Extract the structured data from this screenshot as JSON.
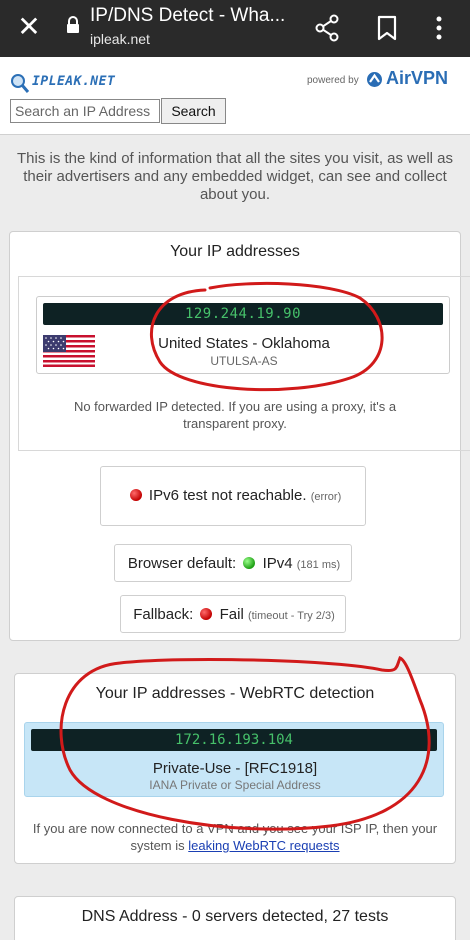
{
  "browser": {
    "close_icon": "close-icon",
    "lock_icon": "lock-icon",
    "title": "IP/DNS Detect - Wha...",
    "url": "ipleak.net",
    "share_icon": "share-icon",
    "bookmark_icon": "bookmark-icon",
    "menu_icon": "more-vert-icon"
  },
  "header": {
    "logo": "IPLEAK.NET",
    "powered_by": "powered by",
    "brand": "AirVPN",
    "search_placeholder": "Search an IP Address",
    "search_button": "Search"
  },
  "intro": "This is the kind of information that all the sites you visit, as well as their advertisers and any embedded widget, can see and collect about you.",
  "ip_panel": {
    "title": "Your IP addresses",
    "ip": "129.244.19.90",
    "country": "United States - Oklahoma",
    "isp": "UTULSA-AS",
    "forward_note": "No forwarded IP detected. If you are using a proxy, it's a transparent proxy.",
    "ipv6": {
      "label": "IPv6 test not reachable.",
      "detail": "(error)"
    },
    "browser_default": {
      "label": "Browser default:",
      "value": "IPv4",
      "detail": "(181 ms)"
    },
    "fallback": {
      "label": "Fallback:",
      "value": "Fail",
      "detail": "(timeout - Try 2/3)"
    }
  },
  "webrtc_panel": {
    "title": "Your IP addresses - WebRTC detection",
    "ip": "172.16.193.104",
    "type": "Private-Use - [RFC1918]",
    "sub": "IANA Private or Special Address",
    "note_prefix": "If you are now connected to a VPN and you see your ISP IP, then your system is",
    "note_link": "leaking WebRTC requests"
  },
  "dns_panel": {
    "title": "DNS Address - 0 servers detected, 27 tests"
  },
  "colors": {
    "annotation": "#d11a1a",
    "ip_text": "#46c06a",
    "ip_bar": "#0e2224",
    "webrtc_card": "#c7e6f7",
    "brand": "#2a6db5",
    "link": "#1a3fb3"
  }
}
